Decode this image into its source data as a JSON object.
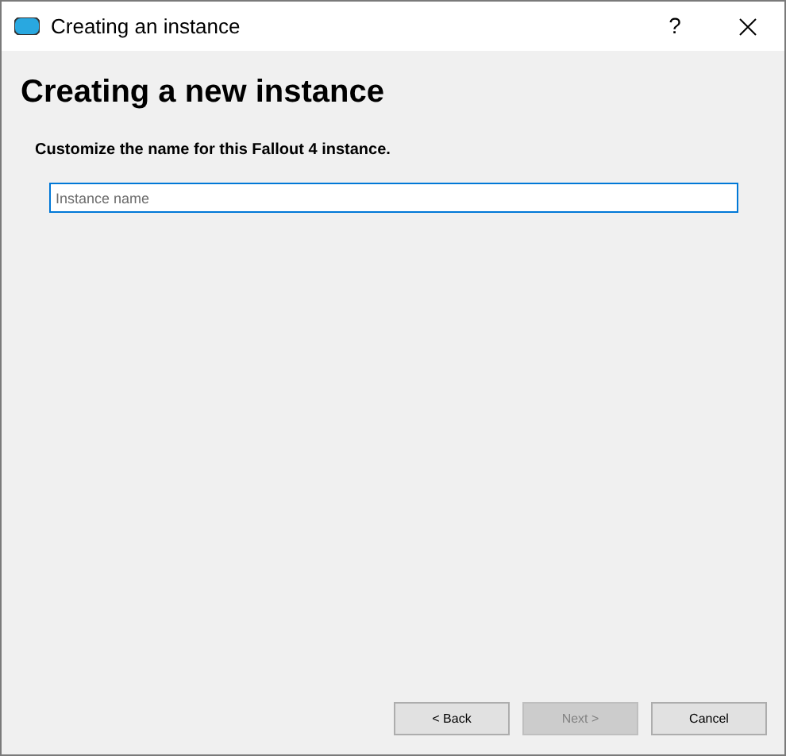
{
  "window": {
    "title": "Creating an instance",
    "help": "?"
  },
  "heading": "Creating a new instance",
  "prompt": "Customize the name for this Fallout 4 instance.",
  "name_field": {
    "placeholder": "Instance name",
    "focused": true
  },
  "buttons": [
    {
      "label": "< Back",
      "disabled": false
    },
    {
      "label": "Next >",
      "disabled": true
    },
    {
      "label": "Cancel",
      "disabled": false
    }
  ]
}
